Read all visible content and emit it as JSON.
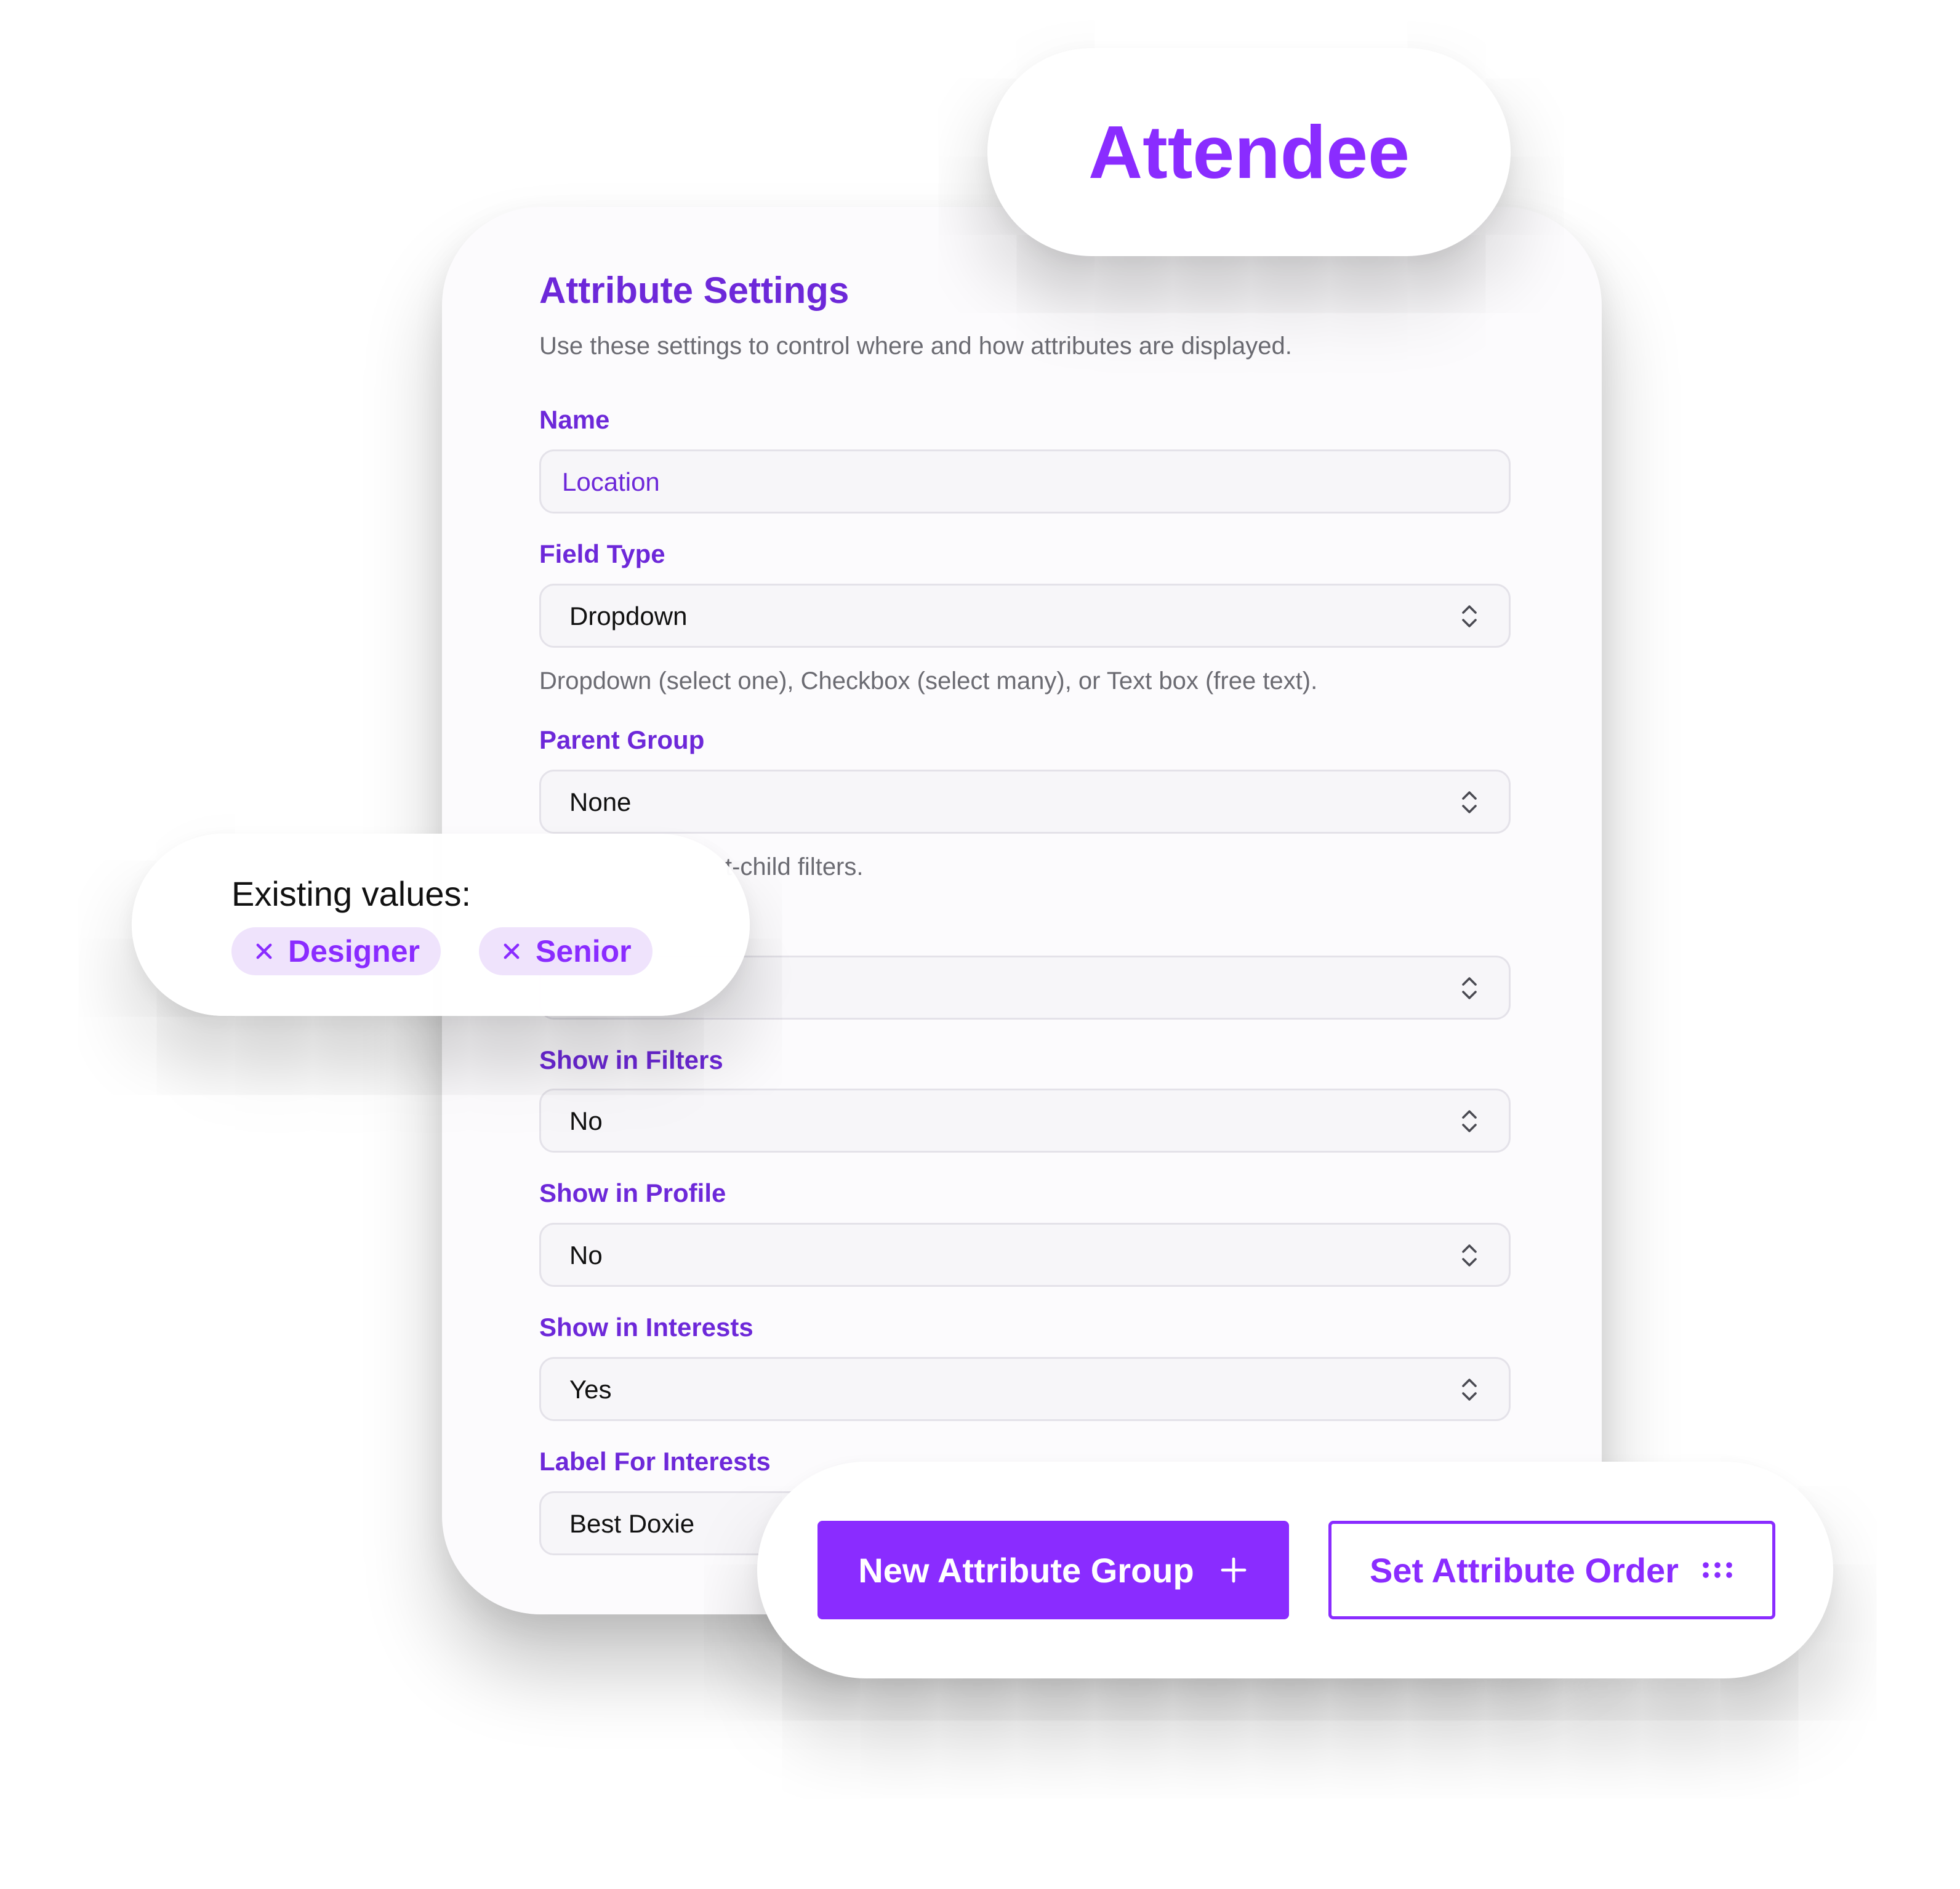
{
  "badge": {
    "label": "Attendee"
  },
  "settings": {
    "title": "Attribute Settings",
    "subtitle": "Use these settings to control where and how attributes are displayed.",
    "name": {
      "label": "Name",
      "value": "Location"
    },
    "field_type": {
      "label": "Field Type",
      "value": "Dropdown",
      "help": "Dropdown (select one), Checkbox (select many), or Text box (free text)."
    },
    "parent_group": {
      "label": "Parent Group",
      "value": "None",
      "help_visible_fragment": "t-child filters."
    },
    "show_in_filters": {
      "label": "Show in Filters",
      "value": "No"
    },
    "show_in_profile": {
      "label": "Show in Profile",
      "value": "No"
    },
    "show_in_interests": {
      "label": "Show in Interests",
      "value": "Yes"
    },
    "label_for_interests": {
      "label": "Label For Interests",
      "value": "Best Doxie"
    }
  },
  "existing_values": {
    "label": "Existing values:",
    "chips": [
      "Designer",
      "Senior"
    ]
  },
  "actions": {
    "new_group_label": "New Attribute Group",
    "set_order_label": "Set Attribute Order"
  },
  "icons": {
    "chevron": "chevron-up-down-icon",
    "remove": "close-icon",
    "add": "plus-icon",
    "order": "drag-dots-icon"
  },
  "colors": {
    "accent": "#8a2cff",
    "label_purple": "#6d28d9",
    "chip_bg": "#efe3fc",
    "muted_text": "#6b6b72"
  }
}
